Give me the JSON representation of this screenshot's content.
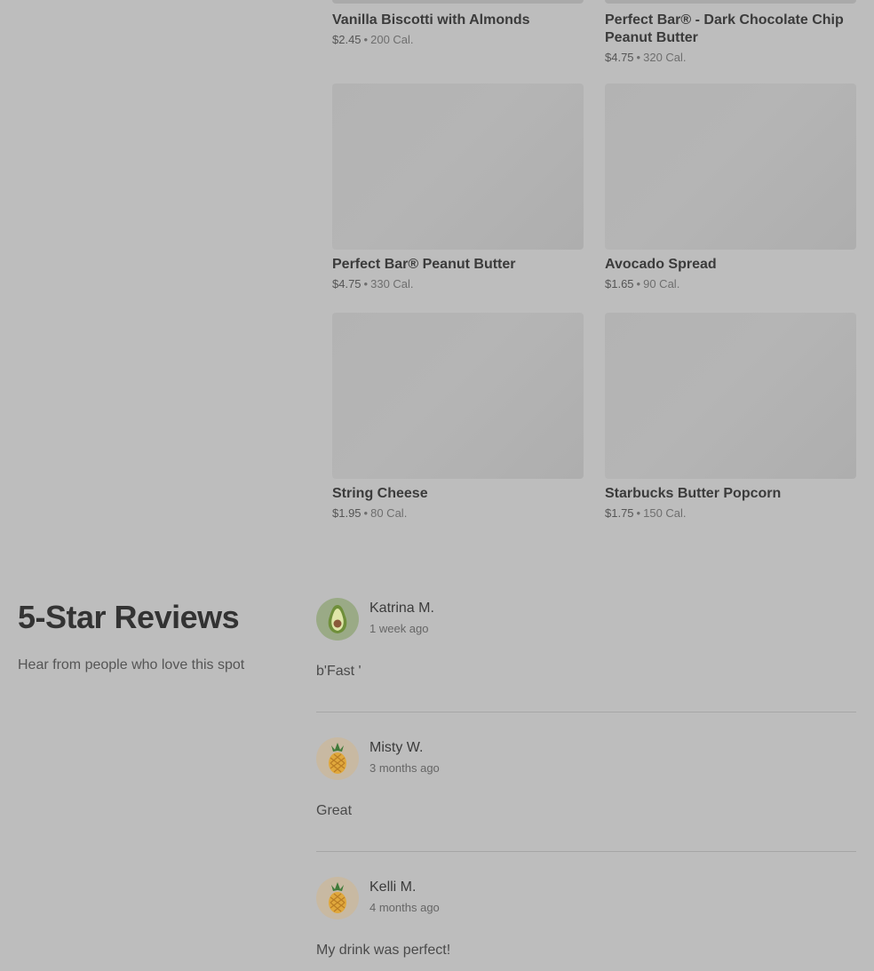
{
  "menu": {
    "top_items": [
      {
        "name": "Vanilla Biscotti with Almonds",
        "price": "$2.45",
        "calories": "200 Cal."
      },
      {
        "name": "Perfect Bar® - Dark Chocolate Chip Peanut Butter",
        "price": "$4.75",
        "calories": "320 Cal."
      }
    ],
    "items": [
      {
        "name": "Perfect Bar® Peanut Butter",
        "price": "$4.75",
        "calories": "330 Cal."
      },
      {
        "name": "Avocado Spread",
        "price": "$1.65",
        "calories": "90 Cal."
      },
      {
        "name": "String Cheese",
        "price": "$1.95",
        "calories": "80 Cal."
      },
      {
        "name": "Starbucks Butter Popcorn",
        "price": "$1.75",
        "calories": "150 Cal."
      }
    ],
    "separator": "•"
  },
  "reviews": {
    "title": "5-Star Reviews",
    "subtitle": "Hear from people who love this spot",
    "list": [
      {
        "name": "Katrina M.",
        "time": "1 week ago",
        "text": "b'Fast '",
        "avatar_icon": "avocado-icon"
      },
      {
        "name": "Misty W.",
        "time": "3 months ago",
        "text": "Great",
        "avatar_icon": "pineapple-icon"
      },
      {
        "name": "Kelli M.",
        "time": "4 months ago",
        "text": "My drink was perfect!",
        "avatar_icon": "pineapple-icon"
      }
    ]
  }
}
